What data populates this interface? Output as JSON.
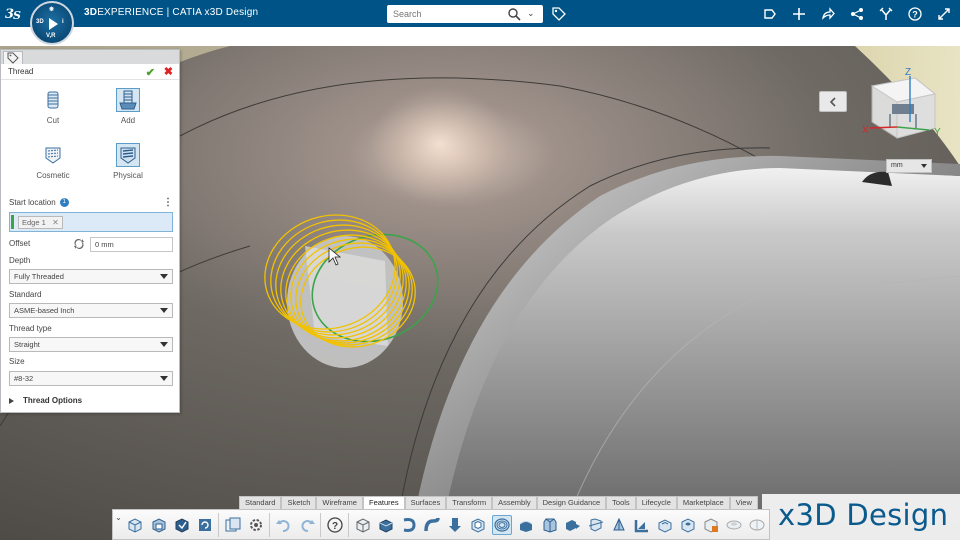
{
  "topbar": {
    "brand_bold": "3D",
    "brand_rest": "EXPERIENCE | CATIA  x3D Design",
    "compass_labels": [
      "3D",
      "V,R"
    ],
    "search_placeholder": "Search",
    "icons": [
      "3ds-logo",
      "search-icon",
      "tag-icon",
      "share-icon",
      "plus-icon",
      "forward-icon",
      "network-icon",
      "tools-icon",
      "help-icon",
      "fullscreen-icon"
    ]
  },
  "panel": {
    "title": "Thread",
    "options": [
      {
        "label": "Cut",
        "selected": false
      },
      {
        "label": "Add",
        "selected": true
      },
      {
        "label": "Cosmetic",
        "selected": false
      },
      {
        "label": "Physical",
        "selected": true
      }
    ],
    "start_location": {
      "label": "Start location",
      "count": "1",
      "chip": "Edge 1"
    },
    "offset": {
      "label": "Offset",
      "value": "0 mm"
    },
    "depth": {
      "label": "Depth",
      "value": "Fully Threaded"
    },
    "standard": {
      "label": "Standard",
      "value": "ASME-based Inch"
    },
    "thread_type": {
      "label": "Thread type",
      "value": "Straight"
    },
    "size": {
      "label": "Size",
      "value": "#8-32"
    },
    "thread_options": "Thread Options"
  },
  "viewport": {
    "axis_labels": {
      "x": "X",
      "y": "Y",
      "z": "Z"
    },
    "units": "mm"
  },
  "action_bar": {
    "tabs": [
      {
        "label": "Standard",
        "active": false
      },
      {
        "label": "Sketch",
        "active": false
      },
      {
        "label": "Wireframe",
        "active": false
      },
      {
        "label": "Features",
        "active": true
      },
      {
        "label": "Surfaces",
        "active": false
      },
      {
        "label": "Transform",
        "active": false
      },
      {
        "label": "Assembly",
        "active": false
      },
      {
        "label": "Design Guidance",
        "active": false
      },
      {
        "label": "Tools",
        "active": false
      },
      {
        "label": "Lifecycle",
        "active": false
      },
      {
        "label": "Marketplace",
        "active": false
      },
      {
        "label": "View",
        "active": false
      }
    ]
  },
  "brand_watermark": "x3D Design",
  "colors": {
    "topbar": "#005386",
    "accent_blue": "#2e7fc1",
    "thread_yellow": "#f2c200",
    "selection_green": "#3ba34a",
    "ok_green": "#4aa02c",
    "cancel_red": "#dd2222"
  }
}
